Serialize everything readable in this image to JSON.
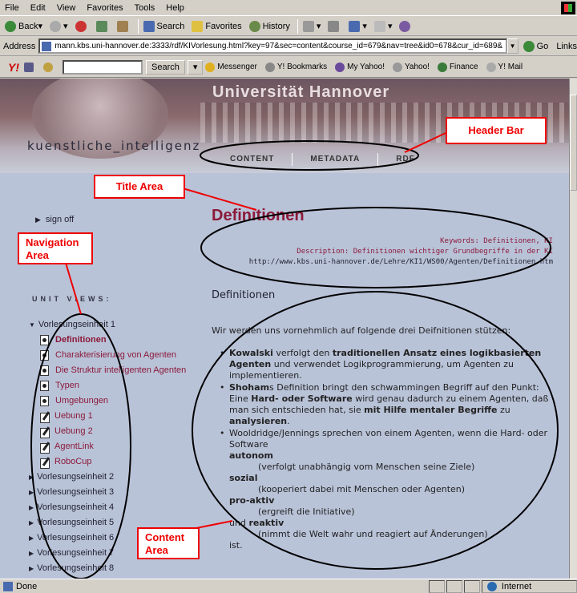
{
  "browser": {
    "menu": [
      "File",
      "Edit",
      "View",
      "Favorites",
      "Tools",
      "Help"
    ],
    "toolbar": {
      "back": "Back",
      "search": "Search",
      "favorites": "Favorites",
      "history": "History"
    },
    "address_label": "Address",
    "address_url": "mann.kbs.uni-hannover.de:3333/rdf/KIVorlesung.html?key=97&sec=content&course_id=679&nav=tree&id0=678&cur_id=689&",
    "go_label": "Go",
    "links_label": "Links",
    "yahoo": {
      "logo": "Y!",
      "search_button": "Search",
      "items": [
        "Messenger",
        "Y! Bookmarks",
        "My Yahoo!",
        "Yahoo!",
        "Finance",
        "Y! Mail"
      ]
    },
    "status": {
      "text": "Done",
      "zone": "Internet"
    },
    "colors": {
      "chrome": "#d4d0c8",
      "page_bg": "#b9c3d8",
      "accent": "#8b1a3a"
    }
  },
  "header": {
    "university": "Universität Hannover",
    "site_title": "kuenstliche_intelligenz",
    "tabs": [
      "CONTENT",
      "METADATA",
      "RDF"
    ]
  },
  "nav": {
    "sign_off": "sign off",
    "unit_views_label": "UNIT VIEWS:",
    "unit1": "Vorlesungseinheit 1",
    "unit1_children": [
      {
        "label": "Definitionen",
        "icon": "document-icon"
      },
      {
        "label": "Charakterisierung von Agenten",
        "icon": "document-icon"
      },
      {
        "label": "Die Struktur intelligenten Agenten",
        "icon": "document-icon"
      },
      {
        "label": "Typen",
        "icon": "document-icon"
      },
      {
        "label": "Umgebungen",
        "icon": "document-icon"
      },
      {
        "label": "Uebung 1",
        "icon": "exercise-icon"
      },
      {
        "label": "Uebung 2",
        "icon": "exercise-icon"
      },
      {
        "label": "AgentLink",
        "icon": "exercise-icon"
      },
      {
        "label": "RoboCup",
        "icon": "exercise-icon"
      }
    ],
    "other_units": [
      "Vorlesungseinheit 2",
      "Vorlesungseinheit 3",
      "Vorlesungseinheit 4",
      "Vorlesungseinheit 5",
      "Vorlesungseinheit 6",
      "Vorlesungseinheit 7",
      "Vorlesungseinheit 8"
    ]
  },
  "content": {
    "title": "Definitionen",
    "keywords": "Keywords: Definitionen, KI",
    "description": "Description: Definitionen wichtiger Grundbegriffe in der KI",
    "url": "http://www.kbs.uni-hannover.de/Lehre/KI1/WS00/Agenten/Definitionen.htm",
    "section_title": "Definitionen",
    "intro": "Wir werden uns vornehmlich auf folgende drei Deifnitionen stützen:",
    "bullet1_a": "Kowalski",
    "bullet1_b": " verfolgt den ",
    "bullet1_c": "traditionellen Ansatz eines logikbasierten Agenten",
    "bullet1_d": " und verwendet Logikprogrammierung, um Agenten zu implementieren.",
    "bullet2_a": "Shoham",
    "bullet2_b": "s Definition bringt den schwammingen Begriff auf den Punkt: Eine ",
    "bullet2_c": "Hard- oder Software",
    "bullet2_d": " wird genau dadurch zu einem Agenten, daß man sich entschieden hat, sie ",
    "bullet2_e": "mit Hilfe mentaler Begriffe",
    "bullet2_f": " zu ",
    "bullet2_g": "analysieren",
    "bullet2_h": ".",
    "bullet3": "Wooldridge/Jennings sprechen von einem Agenten, wenn die Hard- oder Software",
    "terms": [
      {
        "term": "autonom",
        "desc": "(verfolgt unabhängig vom Menschen seine Ziele)"
      },
      {
        "term": "sozial",
        "desc": "(kooperiert dabei mit Menschen oder Agenten)"
      },
      {
        "term": "pro-aktiv",
        "desc": "(ergreift die Initiative)"
      }
    ],
    "reaktiv_pre": "und ",
    "reaktiv_term": "reaktiv",
    "reaktiv_desc": "(nimmt die Welt wahr und reagiert auf Änderungen)",
    "ending": "ist."
  },
  "annotations": {
    "header_bar": "Header Bar",
    "title_area": "Title Area",
    "navigation_area": "Navigation Area",
    "content_area": "Content Area",
    "color": "#e00000"
  }
}
